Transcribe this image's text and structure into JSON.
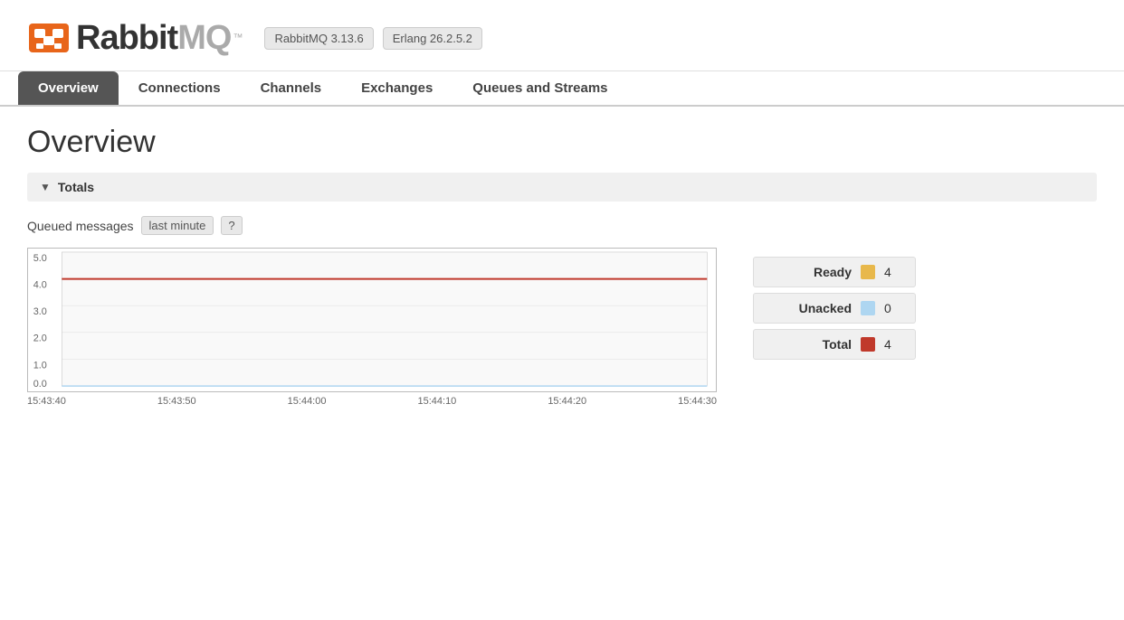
{
  "header": {
    "logo_rabbit": "Rabbit",
    "logo_mq": "MQ",
    "logo_tm": "™",
    "version": "RabbitMQ 3.13.6",
    "erlang": "Erlang 26.2.5.2"
  },
  "nav": {
    "tabs": [
      {
        "label": "Overview",
        "active": true
      },
      {
        "label": "Connections",
        "active": false
      },
      {
        "label": "Channels",
        "active": false
      },
      {
        "label": "Exchanges",
        "active": false
      },
      {
        "label": "Queues and Streams",
        "active": false
      }
    ]
  },
  "page": {
    "title": "Overview",
    "section_title": "Totals",
    "queued_label": "Queued messages",
    "time_badge": "last minute",
    "help_badge": "?"
  },
  "chart": {
    "y_labels": [
      "5.0",
      "4.0",
      "3.0",
      "2.0",
      "1.0",
      "0.0"
    ],
    "x_labels": [
      "15:43:40",
      "15:43:50",
      "15:44:00",
      "15:44:10",
      "15:44:20",
      "15:44:30"
    ]
  },
  "legend": [
    {
      "label": "Ready",
      "color": "#e8b84b",
      "value": "4"
    },
    {
      "label": "Unacked",
      "color": "#aed6f1",
      "value": "0"
    },
    {
      "label": "Total",
      "color": "#c0392b",
      "value": "4"
    }
  ],
  "colors": {
    "orange": "#e8651a",
    "nav_active_bg": "#555555"
  }
}
